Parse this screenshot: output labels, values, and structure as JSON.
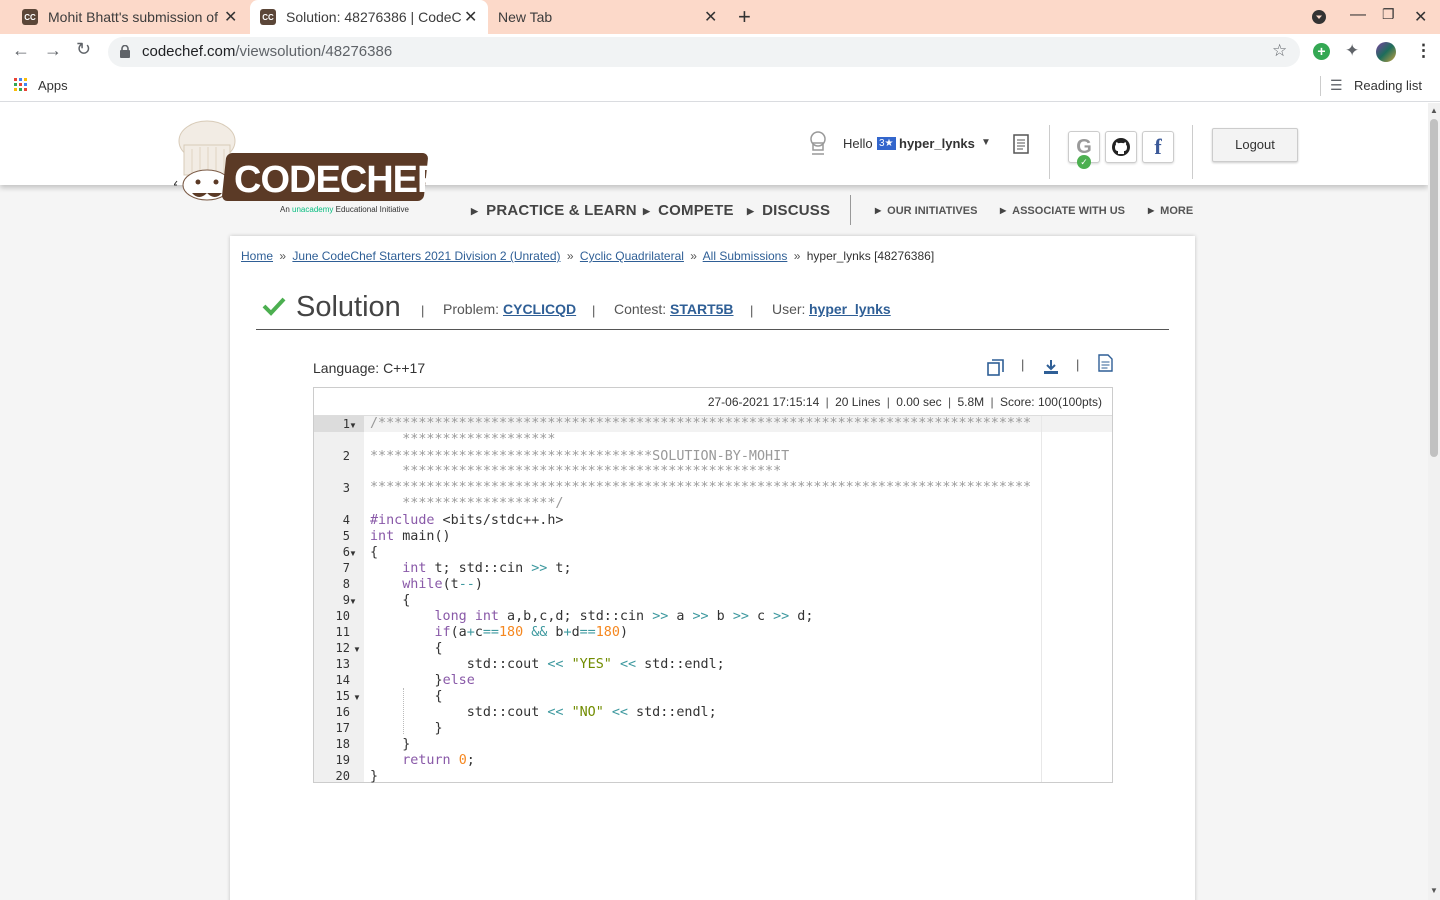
{
  "browser": {
    "tabs": [
      {
        "title": "Mohit Bhatt's submission of"
      },
      {
        "title": "Solution: 48276386 | CodeC"
      },
      {
        "title": "New Tab"
      }
    ],
    "url_domain": "codechef.com",
    "url_path": "/viewsolution/48276386",
    "bookmarks_apps": "Apps",
    "reading_list": "Reading list"
  },
  "header": {
    "logo_text": "CODECHEF",
    "logo_tagline_prefix": "An",
    "logo_tagline_brand": "unacademy",
    "logo_tagline_suffix": "Educational Initiative",
    "hello": "Hello",
    "rating": "3★",
    "username": "hyper_lynks",
    "logout": "Logout",
    "nav_main": [
      "PRACTICE & LEARN",
      "COMPETE",
      "DISCUSS"
    ],
    "nav_small": [
      "OUR INITIATIVES",
      "ASSOCIATE WITH US",
      "MORE"
    ]
  },
  "breadcrumb": {
    "home": "Home",
    "contest": "June CodeChef Starters 2021 Division 2 (Unrated)",
    "problem": "Cyclic Quadrilateral",
    "all_submissions": "All Submissions",
    "current": "hyper_lynks [48276386]"
  },
  "solution": {
    "title": "Solution",
    "problem_label": "Problem:",
    "problem_code": "CYCLICQD",
    "contest_label": "Contest:",
    "contest_code": "START5B",
    "user_label": "User:",
    "user": "hyper_lynks",
    "language": "Language: C++17",
    "date": "27-06-2021 17:15:14",
    "lines": "20 Lines",
    "time": "0.00 sec",
    "memory": "5.8M",
    "score": "Score: 100(100pts)"
  },
  "code": {
    "line_numbers": [
      "1",
      "2",
      "3",
      "4",
      "5",
      "6",
      "7",
      "8",
      "9",
      "10",
      "11",
      "12",
      "13",
      "14",
      "15",
      "16",
      "17",
      "18",
      "19",
      "20"
    ],
    "l1a": "/*********************************************************************************",
    "l1b": "    *******************",
    "l2a": "***********************************",
    "l2b": "SOLUTION-BY-MOHIT",
    "l2c": "    ***********************************************",
    "l3a": "**********************************************************************************",
    "l3b": "    *******************/",
    "l4_pp": "#include",
    "l4_rest": " <bits/stdc++.h>",
    "l5_kw": "int",
    "l5_rest": " main()",
    "brace_open": "{",
    "brace_close": "}",
    "l7_kw": "int",
    "l7_a": " t; std::cin ",
    "op_in": ">>",
    "l7_b": " t;",
    "l8_kw": "while",
    "l8_a": "(t",
    "op_dec": "--",
    "l8_b": ")",
    "l10_kw1": "long",
    "l10_kw2": "int",
    "l10_a": " a,b,c,d; std::cin ",
    "l10_b": " a ",
    "l10_c": " b ",
    "l10_d": " c ",
    "l10_e": " d;",
    "l11_kw": "if",
    "l11_a": "(a",
    "op_plus": "+",
    "l11_b": "c",
    "op_eq": "==",
    "num_180": "180",
    "op_and": "&&",
    "l11_c": " b",
    "l11_d": "d",
    "l11_e": ")",
    "cout": "std::cout ",
    "op_out": "<<",
    "str_yes": "\"YES\"",
    "str_no": "\"NO\"",
    "endl": " std::endl;",
    "l14_kw": "else",
    "l19_kw": "return",
    "num_0": "0",
    "semi": ";"
  }
}
